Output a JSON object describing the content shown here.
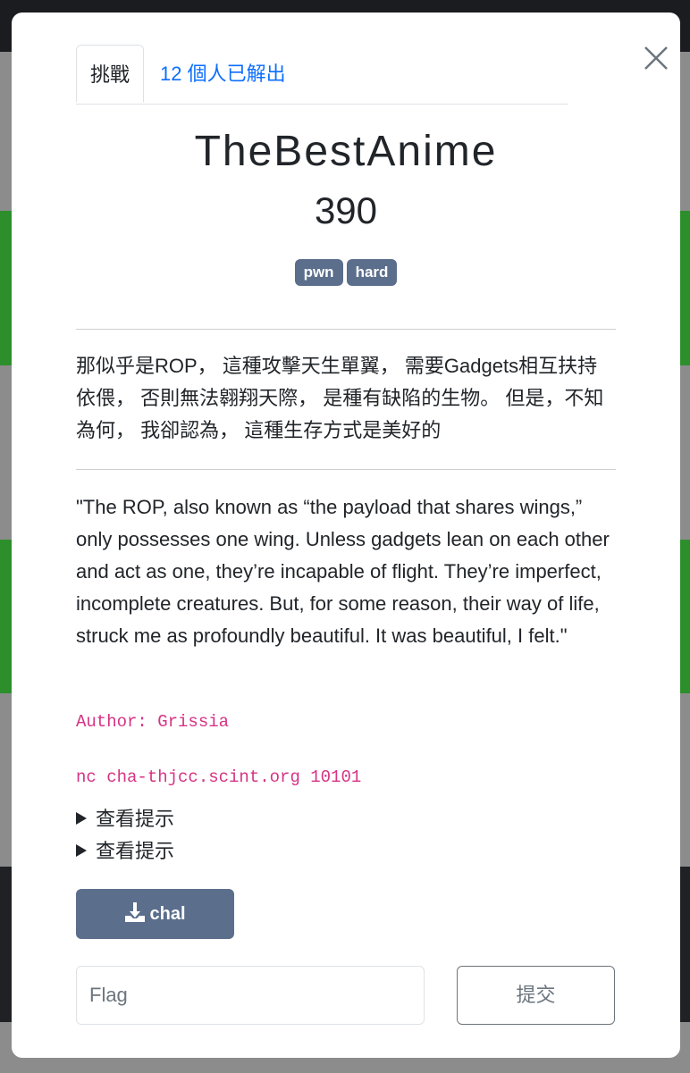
{
  "tabs": {
    "challenge_label": "挑戰",
    "solves_label": "12 個人已解出"
  },
  "challenge": {
    "name": "TheBestAnime",
    "points": "390",
    "tags": [
      "pwn",
      "hard"
    ],
    "description_zh": "那似乎是ROP， 這種攻擊天生單翼， 需要Gadgets相互扶持依偎， 否則無法翱翔天際， 是種有缺陷的生物。 但是，不知為何， 我卻認為， 這種生存方式是美好的",
    "description_en": "\"The ROP, also known as “the payload that shares wings,” only possesses one wing. Unless gadgets lean on each other and act as one, they’re incapable of flight. They’re imperfect, incomplete creatures. But, for some reason, their way of life, struck me as profoundly beautiful. It was beautiful, I felt.\"",
    "author": "Author: Grissia",
    "connection": "nc cha-thjcc.scint.org 10101",
    "hints": [
      "查看提示",
      "查看提示"
    ],
    "file_label": "chal"
  },
  "form": {
    "flag_placeholder": "Flag",
    "flag_value": "",
    "submit_label": "提交"
  },
  "icons": {
    "close": "close-icon",
    "download": "download-icon",
    "hint": "triangle-right-icon"
  },
  "colors": {
    "tag_bg": "#5b6e8c",
    "link": "#0d6efd",
    "code": "#d63384"
  }
}
